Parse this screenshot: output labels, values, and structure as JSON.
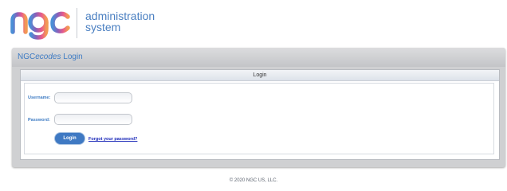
{
  "header": {
    "logo_text": "ngc",
    "system_title_line1": "administration",
    "system_title_line2": "system"
  },
  "login_panel": {
    "title_prefix": "NGC",
    "title_emphasis": "ecodes",
    "title_suffix": " Login",
    "form_header": "Login",
    "username_label": "Username:",
    "username_value": "",
    "password_label": "Password:",
    "password_value": "",
    "login_button_label": "Login",
    "forgot_password_link": "Forgot your password?"
  },
  "footer": {
    "copyright": "© 2020 NGC US, LLC."
  },
  "colors": {
    "brand_blue": "#3f7cc4",
    "logo_gradient": [
      "#4a8fd6",
      "#8b5fb8",
      "#e85a8c",
      "#f29a54"
    ],
    "link_blue": "#1a28b8"
  }
}
